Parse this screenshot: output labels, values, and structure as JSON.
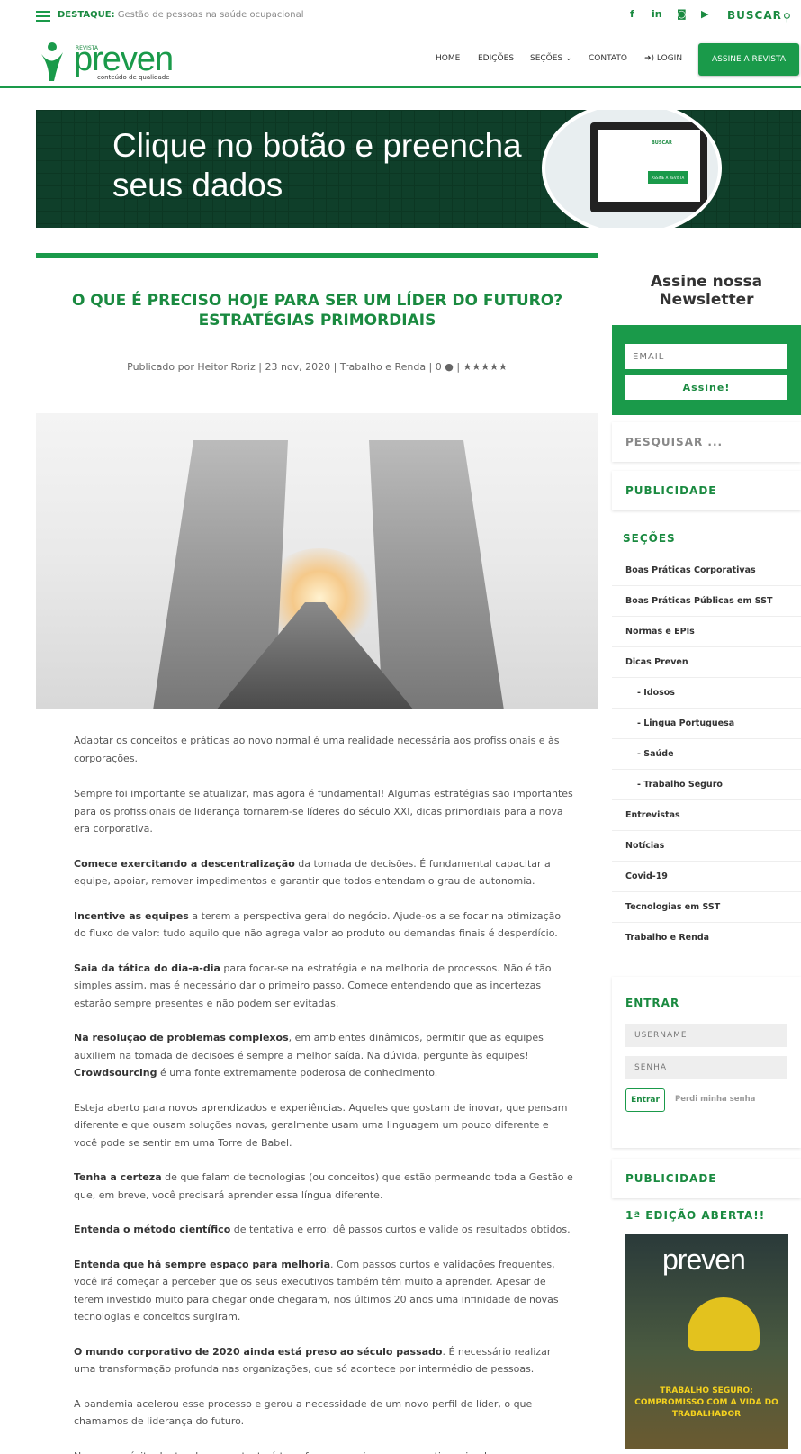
{
  "topbar": {
    "destaque_label": "DESTAQUE:",
    "destaque_text": "Gestão de pessoas na saúde ocupacional",
    "social": [
      "f",
      "in",
      "◙",
      "▶"
    ],
    "buscar": "BUSCAR"
  },
  "header": {
    "logo_small": "REVISTA",
    "logo_main": "preven",
    "logo_sub": "conteúdo de qualidade",
    "nav": [
      "HOME",
      "EDIÇÕES",
      "SEÇÕES ⌄",
      "CONTATO",
      "➜) LOGIN"
    ],
    "subscribe": "ASSINE A REVISTA"
  },
  "banner": {
    "text": "Clique no botão e preencha seus dados",
    "mini_buscar": "BUSCAR",
    "mini_button": "ASSINE A REVISTA"
  },
  "article": {
    "title": "O QUE É PRECISO HOJE PARA SER UM LÍDER DO FUTURO? ESTRATÉGIAS PRIMORDIAIS",
    "meta": "Publicado por Heitor Roriz | 23 nov, 2020 | Trabalho e Renda | 0 ● | ★★★★★",
    "paragraphs": [
      {
        "bold": "",
        "text": "Adaptar os conceitos e práticas ao novo normal é uma realidade necessária aos profissionais e às corporações."
      },
      {
        "bold": "",
        "text": "Sempre foi importante se atualizar, mas agora é fundamental! Algumas estratégias são importantes para os profissionais de liderança tornarem-se líderes do século XXI, dicas primordiais para a nova era corporativa."
      },
      {
        "bold": "Comece exercitando a descentralização",
        "text": " da tomada de decisões. É fundamental capacitar a equipe, apoiar, remover impedimentos e garantir que todos entendam o grau de autonomia."
      },
      {
        "bold": "Incentive as equipes",
        "text": " a terem a perspectiva geral do negócio. Ajude-os a se focar na otimização do fluxo de valor: tudo aquilo que não agrega valor ao produto ou demandas finais é desperdício."
      },
      {
        "bold": "Saia da tática do dia-a-dia",
        "text": " para focar-se na estratégia e na melhoria de processos. Não é tão simples assim, mas é necessário dar o primeiro passo. Comece entendendo que as incertezas estarão sempre presentes e não podem ser evitadas."
      },
      {
        "bold": "Na resolução de problemas complexos",
        "text": ", em ambientes dinâmicos, permitir que as equipes auxiliem na tomada de decisões é sempre a melhor saída. Na dúvida, pergunte às equipes! ",
        "bold2": "Crowdsourcing",
        "text2": " é uma fonte extremamente poderosa de conhecimento."
      },
      {
        "bold": "",
        "text": "Esteja aberto para novos aprendizados e experiências. Aqueles que gostam de inovar, que pensam diferente e que ousam soluções novas, geralmente usam uma linguagem um pouco diferente e você pode se sentir em uma Torre de Babel."
      },
      {
        "bold": "Tenha a certeza",
        "text": " de que falam de tecnologias (ou conceitos) que estão permeando toda a Gestão e que, em breve, você precisará aprender essa língua diferente."
      },
      {
        "bold": "Entenda o método científico",
        "text": " de tentativa e erro: dê passos curtos e valide os resultados obtidos."
      },
      {
        "bold": "Entenda que há sempre espaço para melhoria",
        "text": ". Com passos curtos e validações frequentes, você irá começar a perceber que os seus executivos também têm muito a aprender. Apesar de terem investido muito para chegar onde chegaram, nos últimos 20 anos uma infinidade de novas tecnologias e conceitos surgiram."
      },
      {
        "bold": "O mundo corporativo de 2020 ainda está preso ao século passado",
        "text": ". É necessário realizar uma transformação profunda nas organizações, que só acontece por intermédio de pessoas."
      },
      {
        "bold": "",
        "text": "A pandemia acelerou esse processo e gerou a necessidade de um novo perfil de líder, o que chamamos de liderança do futuro."
      },
      {
        "bold": "",
        "text": "Nosso propósito dentro desse contexto é transformar o universo corporativo criando uma nova forma de gestão de negócios: a Nova Administração."
      }
    ]
  },
  "sidebar": {
    "newsletter_title": "Assine nossa Newsletter",
    "email_placeholder": "EMAIL",
    "newsletter_button": "Assine!",
    "search_placeholder": "PESQUISAR ...",
    "publicidade": "PUBLICIDADE",
    "secoes_title": "SEÇÕES",
    "sections": [
      "Boas Práticas Corporativas",
      "Boas Práticas Públicas em SST",
      "Normas e EPIs",
      "Dicas Preven",
      "- Idosos",
      "- Lingua Portuguesa",
      "- Saúde",
      "- Trabalho Seguro",
      "Entrevistas",
      "Notícias",
      "Covid-19",
      "Tecnologias em SST",
      "Trabalho e Renda"
    ],
    "entrar_title": "ENTRAR",
    "username_placeholder": "USERNAME",
    "password_placeholder": "SENHA",
    "entrar_button": "Entrar",
    "forgot": "Perdi minha senha",
    "publicidade2": "PUBLICIDADE",
    "edicao_title": "1ª EDIÇÃO ABERTA!!",
    "magazine_title": "preven",
    "magazine_headline": "TRABALHO SEGURO: COMPROMISSO COM A VIDA DO TRABALHADOR"
  },
  "colors": {
    "brand_green": "#1a9a4a",
    "dark_green_banner": "#0f3f2a"
  }
}
